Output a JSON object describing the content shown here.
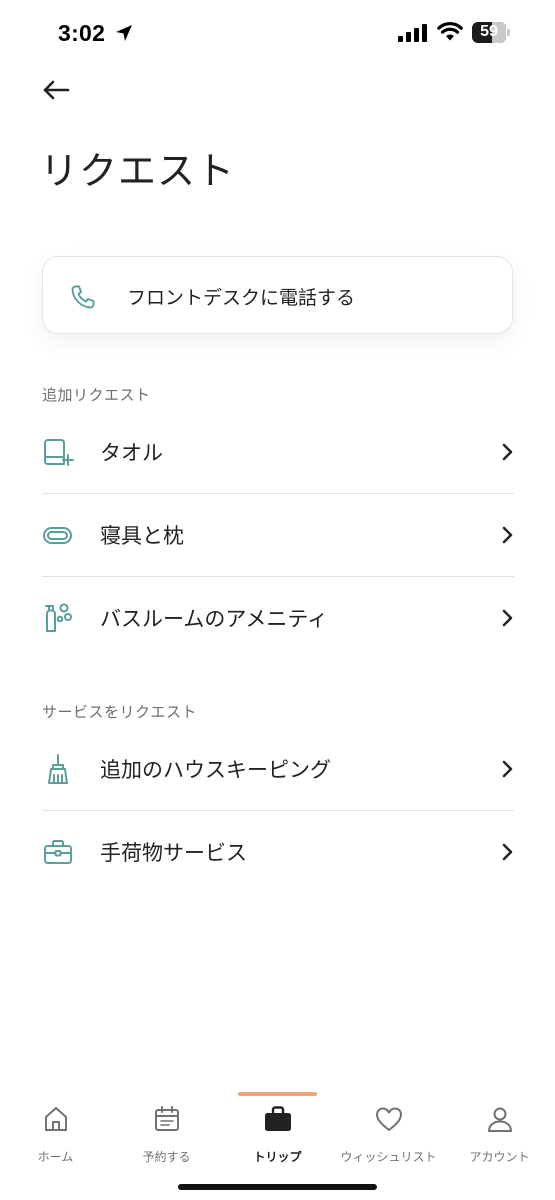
{
  "status_bar": {
    "time": "3:02",
    "battery_level": "59",
    "battery_percent": 59
  },
  "icons": {
    "back": "back-arrow-icon",
    "phone": "phone-icon",
    "towel": "towel-icon",
    "bedding": "pillow-icon",
    "amenities": "toiletries-icon",
    "housekeeping": "broom-icon",
    "luggage": "briefcase-icon",
    "chevron": "chevron-right-icon"
  },
  "colors": {
    "accent_teal": "#5b9e9a",
    "tab_indicator": "#f0a37f",
    "text_primary": "#222222",
    "text_secondary": "#6e6e6e"
  },
  "page": {
    "title": "リクエスト"
  },
  "call_card": {
    "label": "フロントデスクに電話する"
  },
  "sections": [
    {
      "label": "追加リクエスト",
      "items": [
        {
          "label": "タオル"
        },
        {
          "label": "寝具と枕"
        },
        {
          "label": "バスルームのアメニティ"
        }
      ]
    },
    {
      "label": "サービスをリクエスト",
      "items": [
        {
          "label": "追加のハウスキーピング"
        },
        {
          "label": "手荷物サービス"
        }
      ]
    }
  ],
  "tab_bar": {
    "tabs": [
      {
        "label": "ホーム"
      },
      {
        "label": "予約する"
      },
      {
        "label": "トリップ"
      },
      {
        "label": "ウィッシュリスト"
      },
      {
        "label": "アカウント"
      }
    ],
    "active_index": 2
  }
}
